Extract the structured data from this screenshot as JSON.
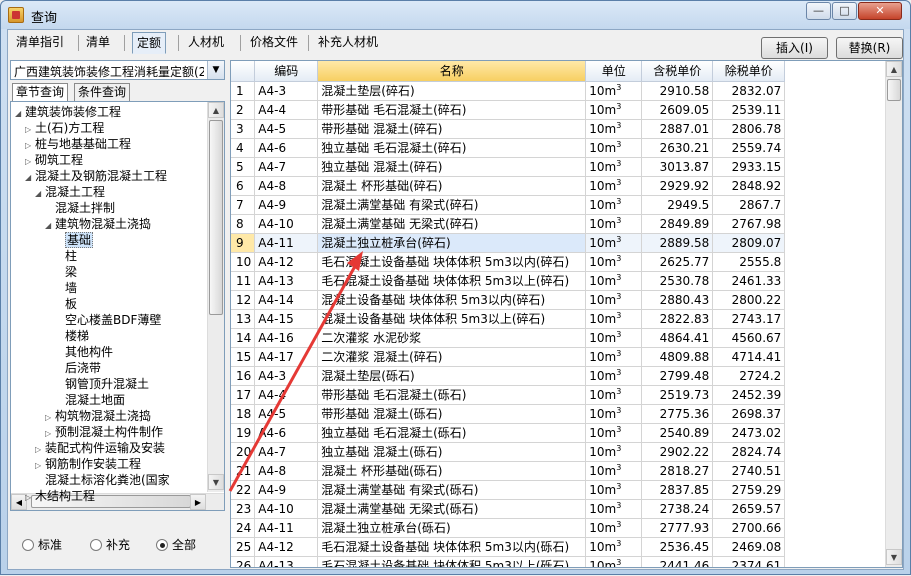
{
  "window": {
    "title": "查询",
    "min": "0",
    "max": "1",
    "close": "r"
  },
  "tabs": [
    {
      "label": "清单指引",
      "active": false
    },
    {
      "label": "清单",
      "active": false
    },
    {
      "label": "定额",
      "active": true
    },
    {
      "label": "人材机",
      "active": false
    },
    {
      "label": "价格文件",
      "active": false
    },
    {
      "label": "补充人材机",
      "active": false
    }
  ],
  "toolbar": {
    "insert_label": "插入(I)",
    "replace_label": "替换(R)"
  },
  "left": {
    "combo_value": "广西建筑装饰装修工程消耗量定额(2",
    "subtabs": [
      {
        "label": "章节查询",
        "active": true
      },
      {
        "label": "条件查询",
        "active": false
      }
    ],
    "tree": [
      {
        "label": "建筑装饰装修工程",
        "toggle": "◢",
        "level": 0
      },
      {
        "label": "土(石)方工程",
        "toggle": "▷",
        "level": 1
      },
      {
        "label": "桩与地基基础工程",
        "toggle": "▷",
        "level": 1
      },
      {
        "label": "砌筑工程",
        "toggle": "▷",
        "level": 1
      },
      {
        "label": "混凝土及钢筋混凝土工程",
        "toggle": "◢",
        "level": 1
      },
      {
        "label": "混凝土工程",
        "toggle": "◢",
        "level": 2
      },
      {
        "label": "混凝土拌制",
        "toggle": "",
        "level": 3
      },
      {
        "label": "建筑物混凝土浇捣",
        "toggle": "◢",
        "level": 3
      },
      {
        "label": "基础",
        "toggle": "",
        "level": 4,
        "selected": true
      },
      {
        "label": "柱",
        "toggle": "",
        "level": 4
      },
      {
        "label": "梁",
        "toggle": "",
        "level": 4
      },
      {
        "label": "墙",
        "toggle": "",
        "level": 4
      },
      {
        "label": "板",
        "toggle": "",
        "level": 4
      },
      {
        "label": "空心楼盖BDF薄壁",
        "toggle": "",
        "level": 4
      },
      {
        "label": "楼梯",
        "toggle": "",
        "level": 4
      },
      {
        "label": "其他构件",
        "toggle": "",
        "level": 4
      },
      {
        "label": "后浇带",
        "toggle": "",
        "level": 4
      },
      {
        "label": "钢管顶升混凝土",
        "toggle": "",
        "level": 4
      },
      {
        "label": "混凝土地面",
        "toggle": "",
        "level": 4
      },
      {
        "label": "构筑物混凝土浇捣",
        "toggle": "▷",
        "level": 3
      },
      {
        "label": "预制混凝土构件制作",
        "toggle": "▷",
        "level": 3
      },
      {
        "label": "装配式构件运输及安装",
        "toggle": "▷",
        "level": 2
      },
      {
        "label": "钢筋制作安装工程",
        "toggle": "▷",
        "level": 2
      },
      {
        "label": "混凝土标溶化粪池(国家",
        "toggle": "",
        "level": 2
      },
      {
        "label": "木结构工程",
        "toggle": "▷",
        "level": 1
      }
    ],
    "radios": [
      {
        "label": "标准",
        "checked": false
      },
      {
        "label": "补充",
        "checked": false
      },
      {
        "label": "全部",
        "checked": true
      }
    ]
  },
  "table": {
    "headers": [
      "编码",
      "名称",
      "单位",
      "含税单价",
      "除税单价"
    ],
    "unit_base": "10m",
    "unit_sup": "3",
    "selected_row": 9,
    "rows": [
      {
        "n": "1",
        "code": "A4-3",
        "name": "混凝土垫层(碎石)",
        "price_tax": "2910.58",
        "price_notax": "2832.07"
      },
      {
        "n": "2",
        "code": "A4-4",
        "name": "带形基础 毛石混凝土(碎石)",
        "price_tax": "2609.05",
        "price_notax": "2539.11"
      },
      {
        "n": "3",
        "code": "A4-5",
        "name": "带形基础 混凝土(碎石)",
        "price_tax": "2887.01",
        "price_notax": "2806.78"
      },
      {
        "n": "4",
        "code": "A4-6",
        "name": "独立基础 毛石混凝土(碎石)",
        "price_tax": "2630.21",
        "price_notax": "2559.74"
      },
      {
        "n": "5",
        "code": "A4-7",
        "name": "独立基础 混凝土(碎石)",
        "price_tax": "3013.87",
        "price_notax": "2933.15"
      },
      {
        "n": "6",
        "code": "A4-8",
        "name": "混凝土 杯形基础(碎石)",
        "price_tax": "2929.92",
        "price_notax": "2848.92"
      },
      {
        "n": "7",
        "code": "A4-9",
        "name": "混凝土满堂基础 有梁式(碎石)",
        "price_tax": "2949.5",
        "price_notax": "2867.7"
      },
      {
        "n": "8",
        "code": "A4-10",
        "name": "混凝土满堂基础 无梁式(碎石)",
        "price_tax": "2849.89",
        "price_notax": "2767.98"
      },
      {
        "n": "9",
        "code": "A4-11",
        "name": "混凝土独立桩承台(碎石)",
        "price_tax": "2889.58",
        "price_notax": "2809.07"
      },
      {
        "n": "10",
        "code": "A4-12",
        "name": "毛石混凝土设备基础 块体体积 5m3以内(碎石)",
        "price_tax": "2625.77",
        "price_notax": "2555.8"
      },
      {
        "n": "11",
        "code": "A4-13",
        "name": "毛石混凝土设备基础 块体体积 5m3以上(碎石)",
        "price_tax": "2530.78",
        "price_notax": "2461.33"
      },
      {
        "n": "12",
        "code": "A4-14",
        "name": "混凝土设备基础 块体体积 5m3以内(碎石)",
        "price_tax": "2880.43",
        "price_notax": "2800.22"
      },
      {
        "n": "13",
        "code": "A4-15",
        "name": "混凝土设备基础 块体体积 5m3以上(碎石)",
        "price_tax": "2822.83",
        "price_notax": "2743.17"
      },
      {
        "n": "14",
        "code": "A4-16",
        "name": "二次灌浆 水泥砂浆",
        "price_tax": "4864.41",
        "price_notax": "4560.67"
      },
      {
        "n": "15",
        "code": "A4-17",
        "name": "二次灌浆 混凝土(碎石)",
        "price_tax": "4809.88",
        "price_notax": "4714.41"
      },
      {
        "n": "16",
        "code": "A4-3",
        "name": "混凝土垫层(砾石)",
        "price_tax": "2799.48",
        "price_notax": "2724.2"
      },
      {
        "n": "17",
        "code": "A4-4",
        "name": "带形基础 毛石混凝土(砾石)",
        "price_tax": "2519.73",
        "price_notax": "2452.39"
      },
      {
        "n": "18",
        "code": "A4-5",
        "name": "带形基础 混凝土(砾石)",
        "price_tax": "2775.36",
        "price_notax": "2698.37"
      },
      {
        "n": "19",
        "code": "A4-6",
        "name": "独立基础 毛石混凝土(砾石)",
        "price_tax": "2540.89",
        "price_notax": "2473.02"
      },
      {
        "n": "20",
        "code": "A4-7",
        "name": "独立基础 混凝土(砾石)",
        "price_tax": "2902.22",
        "price_notax": "2824.74"
      },
      {
        "n": "21",
        "code": "A4-8",
        "name": "混凝土 杯形基础(砾石)",
        "price_tax": "2818.27",
        "price_notax": "2740.51"
      },
      {
        "n": "22",
        "code": "A4-9",
        "name": "混凝土满堂基础 有梁式(砾石)",
        "price_tax": "2837.85",
        "price_notax": "2759.29"
      },
      {
        "n": "23",
        "code": "A4-10",
        "name": "混凝土满堂基础 无梁式(砾石)",
        "price_tax": "2738.24",
        "price_notax": "2659.57"
      },
      {
        "n": "24",
        "code": "A4-11",
        "name": "混凝土独立桩承台(砾石)",
        "price_tax": "2777.93",
        "price_notax": "2700.66"
      },
      {
        "n": "25",
        "code": "A4-12",
        "name": "毛石混凝土设备基础 块体体积 5m3以内(砾石)",
        "price_tax": "2536.45",
        "price_notax": "2469.08"
      },
      {
        "n": "26",
        "code": "A4-13",
        "name": "毛石混凝土设备基础 块体体积 5m3以上(砾石)",
        "price_tax": "2441.46",
        "price_notax": "2374.61"
      }
    ]
  },
  "annotation": {
    "color": "#e53935"
  }
}
